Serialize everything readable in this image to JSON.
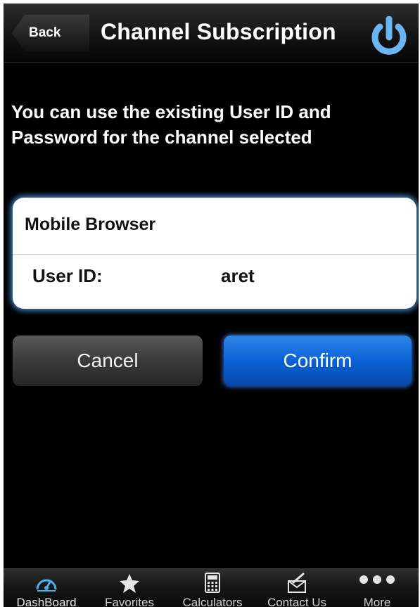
{
  "navbar": {
    "back_label": "Back",
    "title": "Channel Subscription",
    "power_icon": "power-icon"
  },
  "message": "You can use the existing User ID and Password for the channel selected",
  "card": {
    "title": "Mobile Browser",
    "user_id_label": "User ID:",
    "user_id_value": "aret"
  },
  "buttons": {
    "cancel": "Cancel",
    "confirm": "Confirm"
  },
  "tabbar": {
    "items": [
      {
        "label": "DashBoard",
        "icon": "speedometer-icon"
      },
      {
        "label": "Favorites",
        "icon": "star-icon"
      },
      {
        "label": "Calculators",
        "icon": "calculator-icon"
      },
      {
        "label": "Contact Us",
        "icon": "mail-icon"
      },
      {
        "label": "More",
        "icon": "more-dots-icon"
      }
    ]
  },
  "colors": {
    "accent_blue": "#0a62d6",
    "glow": "#5aaaff",
    "power_icon": "#6ab6f0"
  }
}
